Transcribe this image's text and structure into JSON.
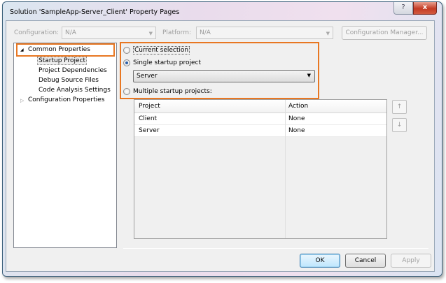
{
  "window": {
    "title": "Solution 'SampleApp-Server_Client' Property Pages",
    "help_label": "?",
    "close_label": "x"
  },
  "toolbar": {
    "configuration_label": "Configuration:",
    "configuration_value": "N/A",
    "platform_label": "Platform:",
    "platform_value": "N/A",
    "config_manager_label": "Configuration Manager..."
  },
  "tree": {
    "items": [
      {
        "label": "Common Properties",
        "expanded": true
      },
      {
        "label": "Startup Project",
        "selected": true
      },
      {
        "label": "Project Dependencies"
      },
      {
        "label": "Debug Source Files"
      },
      {
        "label": "Code Analysis Settings"
      },
      {
        "label": "Configuration Properties",
        "expanded": false
      }
    ]
  },
  "startup": {
    "current_selection": "Current selection",
    "single": "Single startup project",
    "single_value": "Server",
    "multiple": "Multiple startup projects:"
  },
  "table": {
    "headers": [
      "Project",
      "Action"
    ],
    "rows": [
      [
        "Client",
        "None"
      ],
      [
        "Server",
        "None"
      ]
    ]
  },
  "buttons": {
    "ok": "OK",
    "cancel": "Cancel",
    "apply": "Apply",
    "up": "↑",
    "down": "↓"
  },
  "colors": {
    "highlight": "#e87722"
  }
}
